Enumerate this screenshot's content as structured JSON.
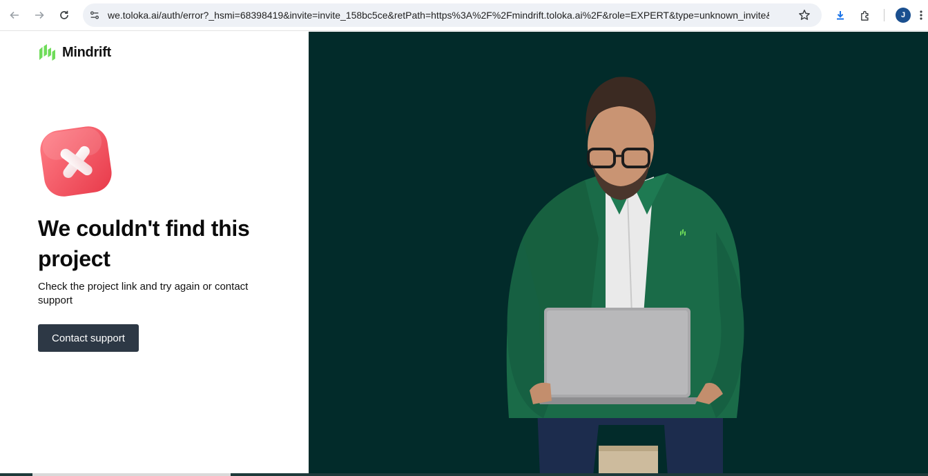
{
  "browser": {
    "url": "we.toloka.ai/auth/error?_hsmi=68398419&invite=invite_158bc5ce&retPath=https%3A%2F%2Fmindrift.toloka.ai%2F&role=EXPERT&type=unknown_invite&utm...",
    "profile_initial": "J",
    "icons": [
      "back-icon",
      "forward-icon",
      "reload-icon",
      "site-info-icon",
      "bookmark-star-icon",
      "download-icon",
      "extensions-icon",
      "menu-icon"
    ]
  },
  "brand": {
    "name": "Mindrift",
    "accent": "#6fdc5a"
  },
  "error": {
    "icon": "error-x-icon",
    "title": "We couldn't find this project",
    "message": "Check the project link and try again or contact support",
    "button_label": "Contact support"
  },
  "colors": {
    "hero_background": "#022b2a",
    "button": "#2d3845",
    "error_icon": "#f2525e"
  }
}
